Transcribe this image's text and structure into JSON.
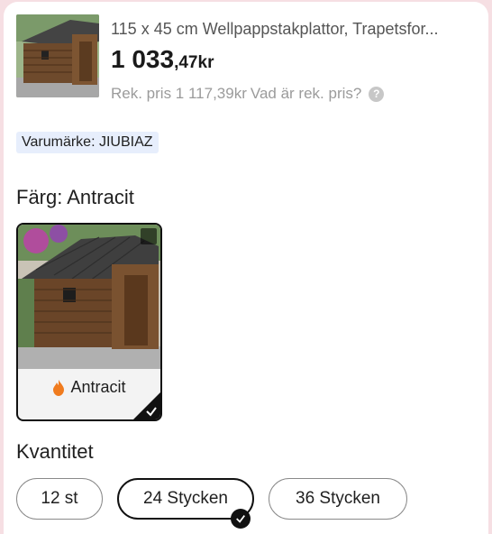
{
  "product": {
    "title": "115 x 45 cm Wellpappstakplattor, Trapetsfor...",
    "price_int": "1 033",
    "price_dec": ",47",
    "currency": "kr",
    "rek_label": "Rek. pris 1 117,39kr",
    "rek_help": "Vad är rek. pris?",
    "help_icon": "question-circle-icon"
  },
  "brand_tag": "Varumärke: JIUBIAZ",
  "color_section": {
    "heading": "Färg: Antracit",
    "options": [
      {
        "label": "Antracit",
        "selected": true,
        "icon": "fire-icon"
      }
    ]
  },
  "quantity_section": {
    "heading": "Kvantitet",
    "options": [
      {
        "label": "12 st",
        "selected": false
      },
      {
        "label": "24 Stycken",
        "selected": true
      },
      {
        "label": "36 Stycken",
        "selected": false
      }
    ]
  },
  "colors": {
    "brand_tag_bg": "#e7eefc",
    "selected_border": "#111111",
    "page_bg": "#f6dfe3",
    "fire": "#f07b1e"
  }
}
